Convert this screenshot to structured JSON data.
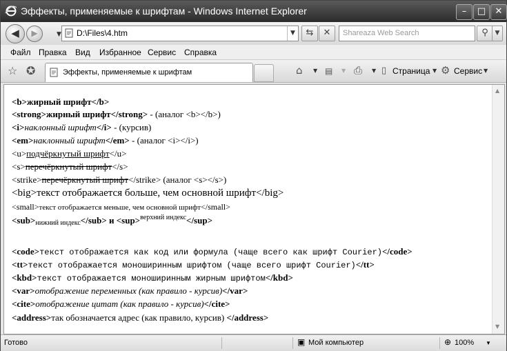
{
  "window": {
    "title": "Эффекты, применяемые к шрифтам - Windows Internet Explorer"
  },
  "address": {
    "url": "D:\\Files\\4.htm"
  },
  "search": {
    "placeholder": "Shareaza Web Search"
  },
  "menu": [
    "Файл",
    "Правка",
    "Вид",
    "Избранное",
    "Сервис",
    "Справка"
  ],
  "tab": {
    "title": "Эффекты, применяемые к шрифтам"
  },
  "commands": {
    "page": "Страница",
    "tools": "Сервис"
  },
  "content": {
    "l1": {
      "o": "<b>",
      "t": "жирный шрифт",
      "c": "</b>"
    },
    "l2": {
      "o": "<strong>",
      "t": "жирный шрифт",
      "c": "</strong>",
      "n": " - (аналог <b></b>)"
    },
    "l3": {
      "o": "<i>",
      "t": "наклонный шрифт",
      "c": "</i>",
      "n": " - (курсив)"
    },
    "l4": {
      "o": "<em>",
      "t": "наклонный шрифт",
      "c": "</em>",
      "n": " - (аналог <i></i>)"
    },
    "l5": {
      "o": "<u>",
      "t": "подчёркнутый шрифт",
      "c": "</u>"
    },
    "l6": {
      "o": "<s>",
      "t": "перечёркнутый шрифт",
      "c": "</s>"
    },
    "l7": {
      "o": "<strike>",
      "t": "перечёркнутый шрифт",
      "c": "</strike>",
      "n": " (аналог <s></s>)"
    },
    "l8": {
      "o": "<big>",
      "t": "текст отображается больше, чем основной шрифт",
      "c": "</big>"
    },
    "l9": {
      "o": "<small>",
      "t": "текст отображается меньше, чем основной шрифт",
      "c": "</small>"
    },
    "l10": {
      "o": "<sub>",
      "t": "нижний индекс",
      "c": "</sub>",
      "m": " и ",
      "o2": "<sup>",
      "t2": "верхний индекс",
      "c2": "</sup>"
    },
    "l11": {
      "o": "<code>",
      "t": "текст отображается как код или формула (чаще всего как шрифт Courier)",
      "c": "</code>"
    },
    "l12": {
      "o": "<tt>",
      "t": "текст отображается моноширинным шрифтом (чаще всего шрифт Courier)",
      "c": "</tt>"
    },
    "l13": {
      "o": "<kbd>",
      "t": "текст отображается моноширинным жирным шрифтом",
      "c": "</kbd>"
    },
    "l14": {
      "o": "<var>",
      "t": "отображение переменных (как правило - курсив)",
      "c": "</var>"
    },
    "l15": {
      "o": "<cite>",
      "t": "отображение цитат (как правило - курсив)",
      "c": "</cite>"
    },
    "l16": {
      "o": "<address>",
      "t": "так обозначается адрес (как правило, курсив) ",
      "c": "</address>"
    }
  },
  "status": {
    "left": "Готово",
    "zone": "Мой компьютер",
    "zoom": "100%"
  }
}
